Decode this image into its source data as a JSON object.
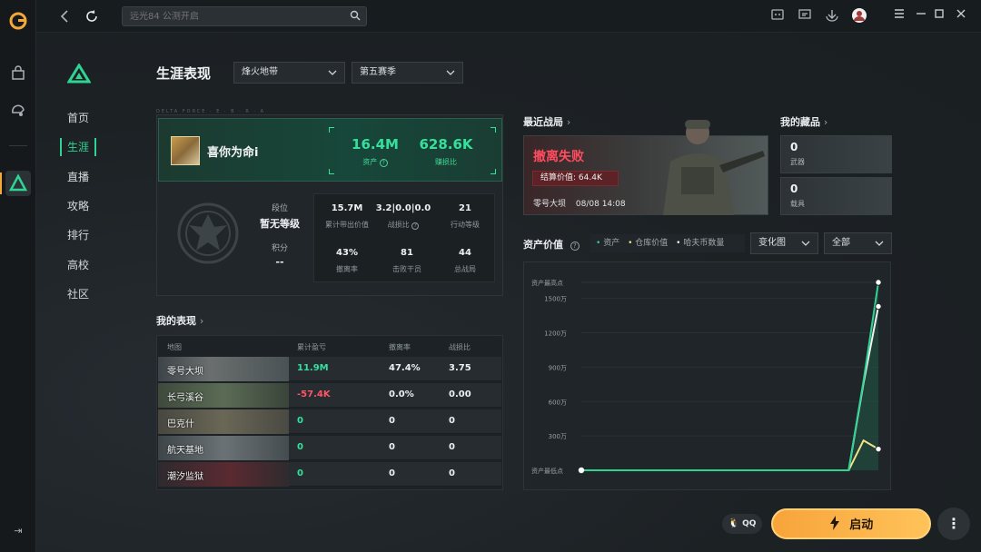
{
  "search": {
    "placeholder": "远光84 公测开启"
  },
  "nav": {
    "items": [
      "首页",
      "生涯",
      "直播",
      "攻略",
      "排行",
      "高校",
      "社区"
    ],
    "active_index": 1
  },
  "page": {
    "title": "生涯表现"
  },
  "filters": {
    "mode": "烽火地带",
    "season": "第五赛季"
  },
  "profile": {
    "card_tag": "DELTA FORCE · E · B · R · A",
    "name": "喜你为命i",
    "assets_value": "16.4M",
    "assets_label": "资产",
    "help_mark": "?",
    "profit_ratio": "628.6K",
    "profit_ratio_label": "赚损比",
    "rank_label": "段位",
    "rank_value": "暂无等级",
    "score_label": "积分",
    "score_value": "--",
    "stats": [
      {
        "value": "15.7M",
        "label": "累计带出价值"
      },
      {
        "value": "3.2|0.0|0.0",
        "label": "战损比"
      },
      {
        "value": "21",
        "label": "行动等级"
      },
      {
        "value": "43%",
        "label": "撤离率"
      },
      {
        "value": "81",
        "label": "击败干员"
      },
      {
        "value": "44",
        "label": "总战局"
      }
    ]
  },
  "performance": {
    "title": "我的表现",
    "headers": [
      "地图",
      "累计盈亏",
      "撤离率",
      "战损比"
    ],
    "rows": [
      {
        "map": "零号大坝",
        "profit": "11.9M",
        "extract": "47.4%",
        "kd": "3.75",
        "profit_sign": "pos"
      },
      {
        "map": "长弓溪谷",
        "profit": "-57.4K",
        "extract": "0.0%",
        "kd": "0.00",
        "profit_sign": "neg"
      },
      {
        "map": "巴克什",
        "profit": "0",
        "extract": "0",
        "kd": "0",
        "profit_sign": "pos"
      },
      {
        "map": "航天基地",
        "profit": "0",
        "extract": "0",
        "kd": "0",
        "profit_sign": "pos"
      },
      {
        "map": "潮汐监狱",
        "profit": "0",
        "extract": "0",
        "kd": "0",
        "profit_sign": "pos"
      }
    ]
  },
  "recent_battle": {
    "title": "最近战局",
    "result": "撤离失败",
    "settle_label": "结算价值:",
    "settle_value": "64.4K",
    "map": "零号大坝",
    "time": "08/08 14:08"
  },
  "collection": {
    "title": "我的藏品",
    "items": [
      {
        "count": "0",
        "label": "武器"
      },
      {
        "count": "0",
        "label": "载具"
      }
    ]
  },
  "asset_chart": {
    "title": "资产价值",
    "help_mark": "?",
    "legend": [
      "资产",
      "仓库价值",
      "哈夫币数量"
    ],
    "view_select": "变化图",
    "range_select": "全部",
    "y_top_label": "资产最高点",
    "y_bottom_label": "资产最低点"
  },
  "chart_data": {
    "type": "line",
    "title": "资产价值",
    "y_ticks": [
      "1500万",
      "1200万",
      "900万",
      "600万",
      "300万"
    ],
    "ylim": [
      0,
      1640
    ],
    "series": [
      {
        "name": "资产",
        "values": [
          0,
          0,
          0,
          0,
          0,
          0,
          0,
          0,
          0,
          0,
          0,
          0,
          0,
          0,
          0,
          0,
          0,
          0,
          0,
          780,
          1640
        ]
      },
      {
        "name": "仓库价值",
        "values": [
          0,
          0,
          0,
          0,
          0,
          0,
          0,
          0,
          0,
          0,
          0,
          0,
          0,
          0,
          0,
          0,
          0,
          0,
          0,
          760,
          1430
        ]
      },
      {
        "name": "哈夫币数量",
        "values": [
          0,
          0,
          0,
          0,
          0,
          0,
          0,
          0,
          0,
          0,
          0,
          0,
          0,
          0,
          0,
          0,
          0,
          0,
          0,
          260,
          185
        ]
      }
    ],
    "colors": {
      "asset": "#2fd494",
      "warehouse": "#f0f0f0",
      "coin": "#f3e08a"
    }
  },
  "bottom": {
    "qq_label": "QQ",
    "launch_label": "启动",
    "more_label": "⋮"
  },
  "colors": {
    "accent": "#2fd494",
    "danger": "#ff4d5e",
    "launch": "#f7a43a"
  }
}
